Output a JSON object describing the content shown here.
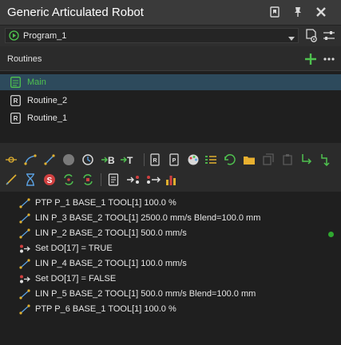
{
  "window": {
    "title": "Generic Articulated Robot"
  },
  "program": {
    "selected": "Program_1"
  },
  "routines": {
    "header": "Routines",
    "items": [
      {
        "label": "Main",
        "selected": true
      },
      {
        "label": "Routine_2",
        "selected": false
      },
      {
        "label": "Routine_1",
        "selected": false
      }
    ]
  },
  "commands": [
    {
      "icon": "motion-icon",
      "text": "PTP P_1 BASE_1 TOOL[1] 100.0 %"
    },
    {
      "icon": "motion-icon",
      "text": "LIN P_3 BASE_2 TOOL[1] 2500.0  mm/s Blend=100.0 mm"
    },
    {
      "icon": "motion-icon",
      "text": "LIN P_2 BASE_2 TOOL[1] 500.0  mm/s"
    },
    {
      "icon": "digital-output-icon",
      "text": "Set DO[17] = TRUE"
    },
    {
      "icon": "motion-icon",
      "text": "LIN P_4 BASE_2 TOOL[1] 100.0  mm/s"
    },
    {
      "icon": "digital-output-icon",
      "text": "Set DO[17] = FALSE"
    },
    {
      "icon": "motion-icon",
      "text": "LIN P_5 BASE_2 TOOL[1] 500.0  mm/s Blend=100.0 mm"
    },
    {
      "icon": "motion-icon",
      "text": "PTP P_6 BASE_1 TOOL[1] 100.0 %"
    }
  ],
  "colors": {
    "accent_green": "#4fc24f",
    "selection": "#2d4a5c",
    "status": "#2fa82f"
  }
}
